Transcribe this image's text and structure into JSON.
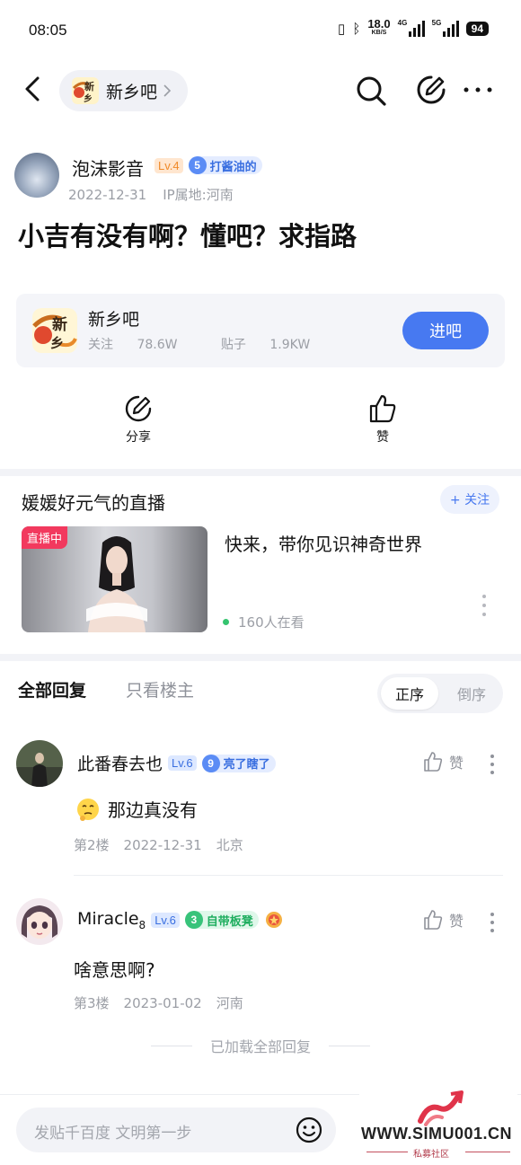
{
  "status_bar": {
    "time": "08:05",
    "speed_value": "18.0",
    "speed_unit": "KB/S",
    "network_1": "4G",
    "network_2": "5G",
    "battery": "94"
  },
  "nav": {
    "forum_name": "新乡吧",
    "logo_char_1": "新",
    "logo_char_2": "乡"
  },
  "post": {
    "author_name": "泡沫影音",
    "author_level": "Lv.4",
    "author_honor_num": "5",
    "author_honor": "打酱油的",
    "date": "2022-12-31",
    "ip_location": "IP属地:河南",
    "title": "小吉有没有啊？懂吧？求指路"
  },
  "forum_card": {
    "name": "新乡吧",
    "followers_label": "关注",
    "followers": "78.6W",
    "posts_label": "贴子",
    "posts": "1.9KW",
    "join_label": "进吧"
  },
  "actions": {
    "share_label": "分享",
    "like_label": "赞"
  },
  "live": {
    "title": "媛媛好元气的直播",
    "follow_label": "+ 关注",
    "tag": "直播中",
    "description": "快来，带你见识神奇世界",
    "watching": "160人在看"
  },
  "filters": {
    "all_replies": "全部回复",
    "op_only": "只看楼主",
    "sort_asc": "正序",
    "sort_desc": "倒序"
  },
  "replies": [
    {
      "name": "此番春去也",
      "name_sub": "",
      "level": "Lv.6",
      "honor_num": "9",
      "honor": "亮了瞎了",
      "like_label": "赞",
      "text": "那边真没有",
      "floor": "第2楼",
      "date": "2022-12-31",
      "location": "北京"
    },
    {
      "name": "Miracle",
      "name_sub": "8",
      "level": "Lv.6",
      "honor_num": "3",
      "honor": "自带板凳",
      "like_label": "赞",
      "text": "啥意思啊?",
      "floor": "第3楼",
      "date": "2023-01-02",
      "location": "河南"
    }
  ],
  "loaded_all": "已加载全部回复",
  "bottom": {
    "input_placeholder": "发贴千百度 文明第一步"
  },
  "watermark": {
    "url": "WWW.SIMU001.CN",
    "sub": "私募社区"
  },
  "colors": {
    "accent": "#4779f1",
    "live_tag": "#f2395e",
    "level_orange": "#f08a2a",
    "level_blue": "#3a6fe0",
    "honor_green": "#1fae5f"
  }
}
